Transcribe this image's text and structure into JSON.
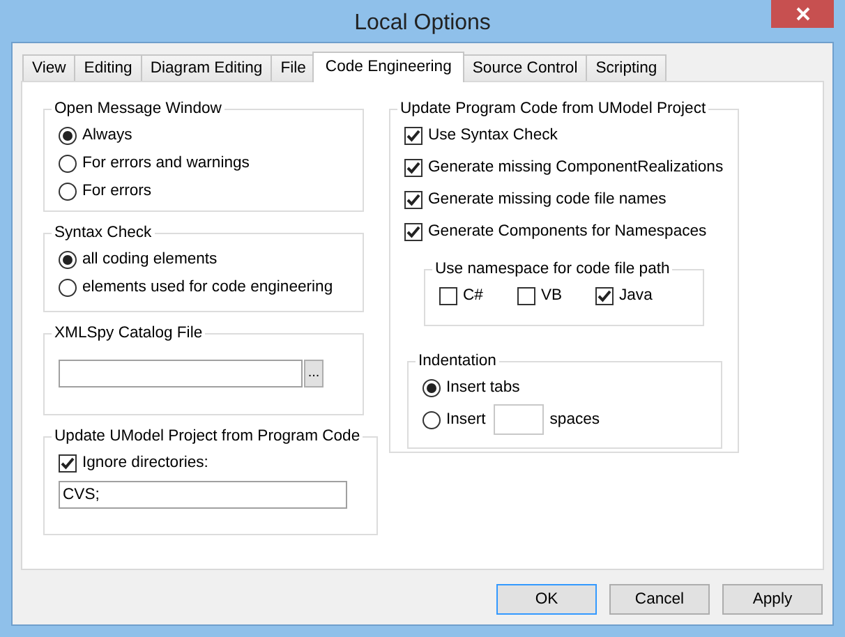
{
  "window": {
    "title": "Local Options"
  },
  "tabs": [
    {
      "label": "View",
      "selected": false
    },
    {
      "label": "Editing",
      "selected": false
    },
    {
      "label": "Diagram Editing",
      "selected": false
    },
    {
      "label": "File",
      "selected": false
    },
    {
      "label": "Code Engineering",
      "selected": true
    },
    {
      "label": "Source Control",
      "selected": false
    },
    {
      "label": "Scripting",
      "selected": false
    }
  ],
  "left_column": [
    {
      "title": "Open Message Window",
      "items": [
        {
          "kind": "radio",
          "label": "Always",
          "selected": true
        },
        {
          "kind": "radio",
          "label": "For errors and warnings",
          "selected": false
        },
        {
          "kind": "radio",
          "label": "For errors",
          "selected": false
        }
      ]
    },
    {
      "title": "Syntax Check",
      "items": [
        {
          "kind": "radio",
          "label": "all coding elements",
          "selected": true
        },
        {
          "kind": "radio",
          "label": "elements used for code engineering",
          "selected": false
        }
      ]
    },
    {
      "title": "XMLSpy Catalog File",
      "items": [
        {
          "kind": "file",
          "button": "..."
        }
      ]
    },
    {
      "title": "Update UModel Project from Program Code",
      "items": [
        {
          "kind": "checkbox",
          "label": "Ignore directories:",
          "checked": true
        },
        {
          "kind": "text",
          "value": "CVS;"
        }
      ]
    }
  ],
  "right_column": [
    {
      "title": "Update Program Code from UModel Project",
      "items": [
        {
          "kind": "checkbox",
          "label": "Use Syntax Check",
          "checked": true
        },
        {
          "kind": "checkbox",
          "label": "Generate missing ComponentRealizations",
          "checked": true
        },
        {
          "kind": "checkbox",
          "label": "Generate missing code file names",
          "checked": true
        },
        {
          "kind": "checkbox",
          "label": "Generate Components for Namespaces",
          "checked": true
        },
        {
          "kind": "option-row",
          "title": "Use namespace for code file path",
          "items": [
            {
              "kind": "checkbox",
              "label": "C#",
              "checked": false
            },
            {
              "kind": "checkbox",
              "label": "VB",
              "checked": false
            },
            {
              "kind": "checkbox",
              "label": "Java",
              "checked": true
            }
          ]
        },
        {
          "kind": "group",
          "title": "Indentation",
          "items": [
            {
              "kind": "radio",
              "label": "Insert tabs",
              "selected": true
            },
            {
              "kind": "radio",
              "label": "Insert",
              "suffix": "spaces",
              "selected": false
            }
          ]
        }
      ]
    }
  ],
  "buttons": [
    {
      "label": "OK",
      "default": true
    },
    {
      "label": "Cancel",
      "default": false
    },
    {
      "label": "Apply",
      "default": false
    }
  ]
}
